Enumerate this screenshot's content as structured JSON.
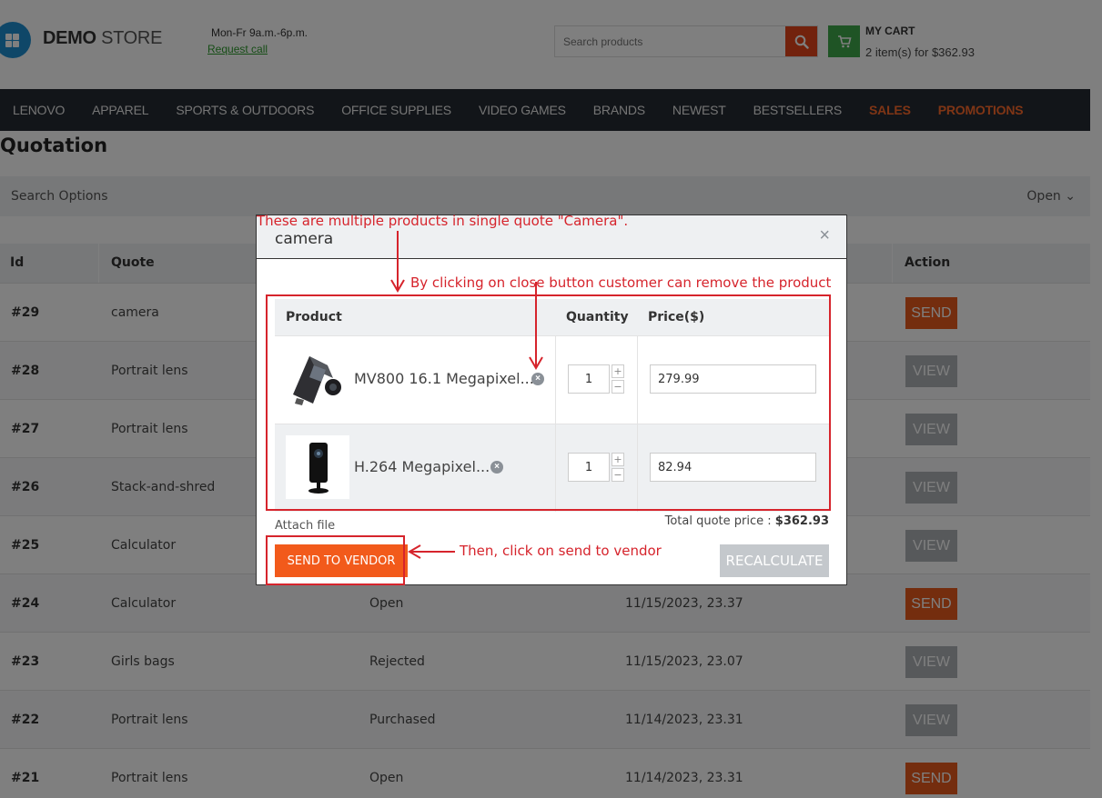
{
  "store": {
    "logo_bold": "DEMO",
    "logo_light": "STORE",
    "hours": "Mon-Fr 9a.m.-6p.m.",
    "request_call": "Request call",
    "search_placeholder": "Search products",
    "cart_title": "MY CART",
    "cart_summary": "2 item(s) for $362.93"
  },
  "nav": [
    {
      "label": "LENOVO",
      "hot": false
    },
    {
      "label": "APPAREL",
      "hot": false
    },
    {
      "label": "SPORTS & OUTDOORS",
      "hot": false
    },
    {
      "label": "OFFICE SUPPLIES",
      "hot": false
    },
    {
      "label": "VIDEO GAMES",
      "hot": false
    },
    {
      "label": "BRANDS",
      "hot": false
    },
    {
      "label": "NEWEST",
      "hot": false
    },
    {
      "label": "BESTSELLERS",
      "hot": false
    },
    {
      "label": "SALES",
      "hot": true
    },
    {
      "label": "PROMOTIONS",
      "hot": true
    }
  ],
  "page": {
    "title": "Quotation",
    "search_options": "Search Options",
    "filter_status": "Open"
  },
  "table": {
    "headers": {
      "id": "Id",
      "quote": "Quote",
      "action": "Action"
    },
    "rows": [
      {
        "id": "#29",
        "quote": "camera",
        "status": "",
        "date": "",
        "action": "SEND"
      },
      {
        "id": "#28",
        "quote": "Portrait lens",
        "status": "",
        "date": "",
        "action": "VIEW"
      },
      {
        "id": "#27",
        "quote": "Portrait lens",
        "status": "",
        "date": "",
        "action": "VIEW"
      },
      {
        "id": "#26",
        "quote": "Stack-and-shred",
        "status": "",
        "date": "",
        "action": "VIEW"
      },
      {
        "id": "#25",
        "quote": "Calculator",
        "status": "",
        "date": "",
        "action": "VIEW"
      },
      {
        "id": "#24",
        "quote": "Calculator",
        "status": "Open",
        "date": "11/15/2023, 23.37",
        "action": "SEND"
      },
      {
        "id": "#23",
        "quote": "Girls bags",
        "status": "Rejected",
        "date": "11/15/2023, 23.07",
        "action": "VIEW"
      },
      {
        "id": "#22",
        "quote": "Portrait lens",
        "status": "Purchased",
        "date": "11/14/2023, 23.31",
        "action": "VIEW"
      },
      {
        "id": "#21",
        "quote": "Portrait lens",
        "status": "Open",
        "date": "11/14/2023, 23.31",
        "action": "SEND"
      }
    ]
  },
  "modal": {
    "title": "camera",
    "close_glyph": "×",
    "headers": {
      "product": "Product",
      "quantity": "Quantity",
      "price": "Price($)"
    },
    "items": [
      {
        "name": "MV800 16.1 Megapixel...",
        "qty": "1",
        "price": "279.99"
      },
      {
        "name": "H.264 Megapixel...",
        "qty": "1",
        "price": "82.94"
      }
    ],
    "attach": "Attach file",
    "total_label": "Total quote price :",
    "total_value": "$362.93",
    "send_vendor": "SEND TO VENDOR",
    "recalculate": "RECALCULATE"
  },
  "annotations": {
    "multiple_products": "These are multiple products in single quote \"Camera\".",
    "close_remove": "By clicking on close button customer can remove the product",
    "send_vendor": "Then, click on send to vendor"
  },
  "colors": {
    "accent_orange": "#f25a1b",
    "nav_bg": "#252b33",
    "cart_green": "#3ea84a",
    "annotation_red": "#d6242c"
  }
}
